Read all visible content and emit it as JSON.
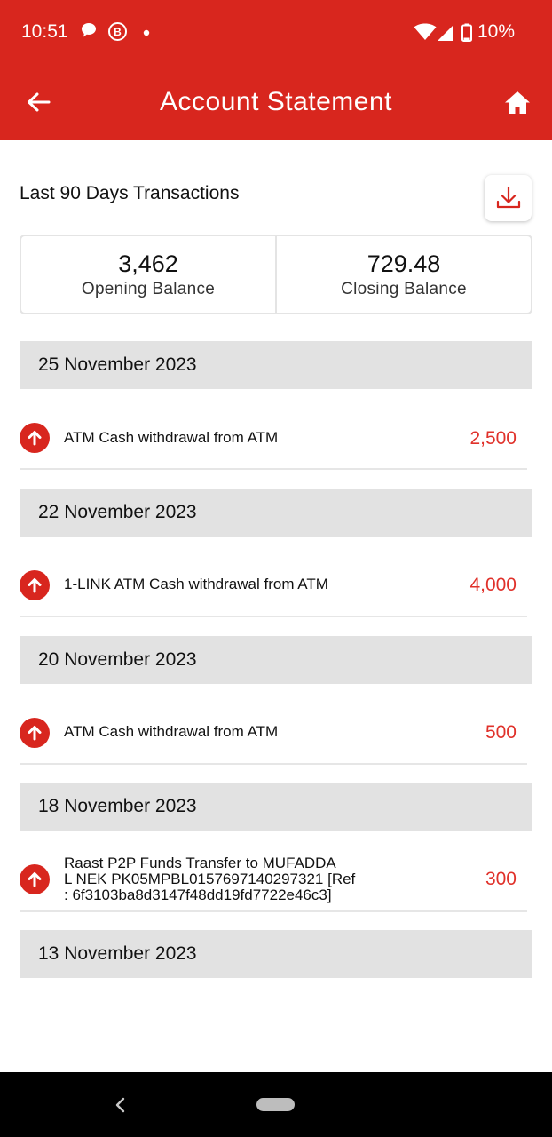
{
  "status_bar": {
    "time": "10:51",
    "battery_text": "10%",
    "icons": [
      "chat-bubble-icon",
      "b-circle-icon",
      "dot-icon",
      "wifi-icon",
      "signal-icon",
      "battery-icon"
    ]
  },
  "app_bar": {
    "title": "Account Statement",
    "back_icon": "arrow-left-icon",
    "home_icon": "home-icon"
  },
  "heading": "Last 90 Days Transactions",
  "download_icon": "download-icon",
  "balances": {
    "opening_value": "3,462",
    "opening_label": "Opening Balance",
    "closing_value": "729.48",
    "closing_label": "Closing Balance"
  },
  "groups": [
    {
      "date": "25 November 2023",
      "transactions": [
        {
          "description": "ATM Cash withdrawal from ATM",
          "amount": "2,500"
        }
      ]
    },
    {
      "date": "22 November 2023",
      "transactions": [
        {
          "description": "1-LINK ATM Cash withdrawal from ATM",
          "amount": "4,000"
        }
      ]
    },
    {
      "date": "20 November 2023",
      "transactions": [
        {
          "description": "ATM Cash withdrawal from ATM",
          "amount": "500"
        }
      ]
    },
    {
      "date": "18 November 2023",
      "transactions": [
        {
          "description": "Raast P2P Funds Transfer to MUFADDA\nL NEK PK05MPBL0157697140297321 [Ref\n: 6f3103ba8d3147f48dd19fd7722e46c3]",
          "amount": "300"
        }
      ]
    },
    {
      "date": "13 November 2023",
      "transactions": []
    }
  ],
  "colors": {
    "brand_red": "#d8261e",
    "amount_red": "#e0312a",
    "date_band": "#e2e2e2"
  }
}
